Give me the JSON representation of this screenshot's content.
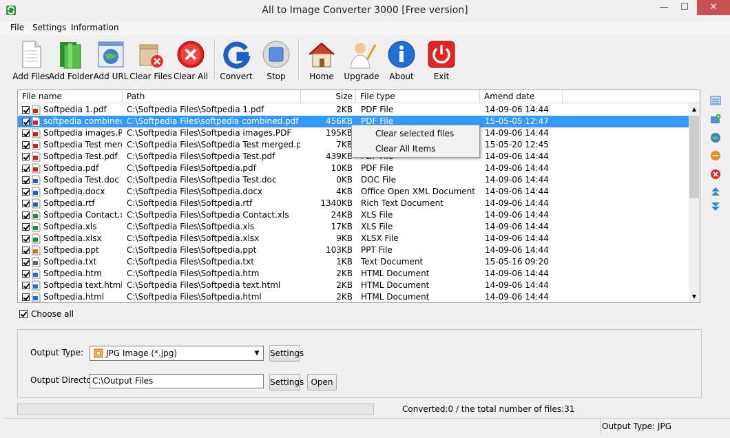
{
  "window": {
    "title": "All to Image Converter 3000 [Free version]"
  },
  "menu": [
    "File",
    "Settings",
    "Information"
  ],
  "toolbar": {
    "add_files": "Add Files",
    "add_folder": "Add Folder",
    "add_url": "Add URL",
    "clear_files": "Clear Files",
    "clear_all": "Clear All",
    "convert": "Convert",
    "stop": "Stop",
    "home": "Home",
    "upgrade": "Upgrade",
    "about": "About",
    "exit": "Exit"
  },
  "table": {
    "columns": [
      "File name",
      "Path",
      "Size",
      "File type",
      "Amend date"
    ],
    "rows": [
      {
        "name": "Softpedia 1.pdf",
        "path": "C:\\Softpedia Files\\Softpedia 1.pdf",
        "size": "2KB",
        "type": "PDF File",
        "date": "14-09-06 14:44",
        "icon": "pdf-icon",
        "selected": false
      },
      {
        "name": "softpedia combined.pdf",
        "path": "C:\\Softpedia Files\\softpedia combined.pdf",
        "size": "456KB",
        "type": "PDF File",
        "date": "15-05-05 12:47",
        "icon": "pdf-icon",
        "selected": true
      },
      {
        "name": "Softpedia images.PDF",
        "path": "C:\\Softpedia Files\\Softpedia images.PDF",
        "size": "195KB",
        "type": "",
        "date": "14-09-06 14:44",
        "icon": "pdf-icon",
        "selected": false
      },
      {
        "name": "Softpedia Test merge...",
        "path": "C:\\Softpedia Files\\Softpedia Test merged.pdf",
        "size": "7KB",
        "type": "",
        "date": "15-05-20 12:45",
        "icon": "pdf-icon",
        "selected": false
      },
      {
        "name": "Softpedia Test.pdf",
        "path": "C:\\Softpedia Files\\Softpedia Test.pdf",
        "size": "439KB",
        "type": "PDF File",
        "date": "14-09-06 14:44",
        "icon": "pdf-icon",
        "selected": false
      },
      {
        "name": "Softpedia.pdf",
        "path": "C:\\Softpedia Files\\Softpedia.pdf",
        "size": "10KB",
        "type": "PDF File",
        "date": "14-09-06 14:44",
        "icon": "pdf-icon",
        "selected": false
      },
      {
        "name": "Softpedia Test.doc",
        "path": "C:\\Softpedia Files\\Softpedia Test.doc",
        "size": "0KB",
        "type": "DOC File",
        "date": "14-09-06 14:44",
        "icon": "word-icon",
        "selected": false
      },
      {
        "name": "Softpedia.docx",
        "path": "C:\\Softpedia Files\\Softpedia.docx",
        "size": "4KB",
        "type": "Office Open XML Document",
        "date": "14-09-06 14:44",
        "icon": "word-icon",
        "selected": false
      },
      {
        "name": "Softpedia.rtf",
        "path": "C:\\Softpedia Files\\Softpedia.rtf",
        "size": "1340KB",
        "type": "Rich Text Document",
        "date": "14-09-06 14:44",
        "icon": "word-icon",
        "selected": false
      },
      {
        "name": "Softpedia Contact.xls",
        "path": "C:\\Softpedia Files\\Softpedia Contact.xls",
        "size": "24KB",
        "type": "XLS File",
        "date": "14-09-06 14:44",
        "icon": "excel-icon",
        "selected": false
      },
      {
        "name": "Softpedia.xls",
        "path": "C:\\Softpedia Files\\Softpedia.xls",
        "size": "17KB",
        "type": "XLS File",
        "date": "14-09-06 14:44",
        "icon": "excel-icon",
        "selected": false
      },
      {
        "name": "Softpedia.xlsx",
        "path": "C:\\Softpedia Files\\Softpedia.xlsx",
        "size": "9KB",
        "type": "XLSX File",
        "date": "14-09-06 14:44",
        "icon": "excel-icon",
        "selected": false
      },
      {
        "name": "Softpedia.ppt",
        "path": "C:\\Softpedia Files\\Softpedia.ppt",
        "size": "103KB",
        "type": "PPT File",
        "date": "14-09-06 14:44",
        "icon": "ppt-icon",
        "selected": false
      },
      {
        "name": "Softpedia.txt",
        "path": "C:\\Softpedia Files\\Softpedia.txt",
        "size": "1KB",
        "type": "Text Document",
        "date": "15-05-16 09:20",
        "icon": "text-icon",
        "selected": false
      },
      {
        "name": "Softpedia.htm",
        "path": "C:\\Softpedia Files\\Softpedia.htm",
        "size": "2KB",
        "type": "HTML Document",
        "date": "14-09-06 14:44",
        "icon": "html-icon",
        "selected": false
      },
      {
        "name": "Softpedia text.html",
        "path": "C:\\Softpedia Files\\Softpedia text.html",
        "size": "2KB",
        "type": "HTML Document",
        "date": "14-09-06 14:44",
        "icon": "html-icon",
        "selected": false
      },
      {
        "name": "Softpedia.html",
        "path": "C:\\Softpedia Files\\Softpedia.html",
        "size": "2KB",
        "type": "HTML Document",
        "date": "14-09-06 14:44",
        "icon": "html-icon",
        "selected": false
      }
    ]
  },
  "context_menu": [
    "Clear selected files",
    "Clear All Items"
  ],
  "choose_all": "Choose all",
  "output": {
    "type_label": "Output Type:",
    "type_value": "JPG Image (*.jpg)",
    "dir_label": "Output Directory:",
    "dir_value": "C:\\Output Files",
    "settings_label": "Settings",
    "open_label": "Open"
  },
  "progress": {
    "converted_text": "Converted:0  /  the total number of files:31"
  },
  "status": {
    "output_type": "Output Type: JPG"
  },
  "colors": {
    "selection": "#3399ff",
    "close": "#c75050"
  }
}
